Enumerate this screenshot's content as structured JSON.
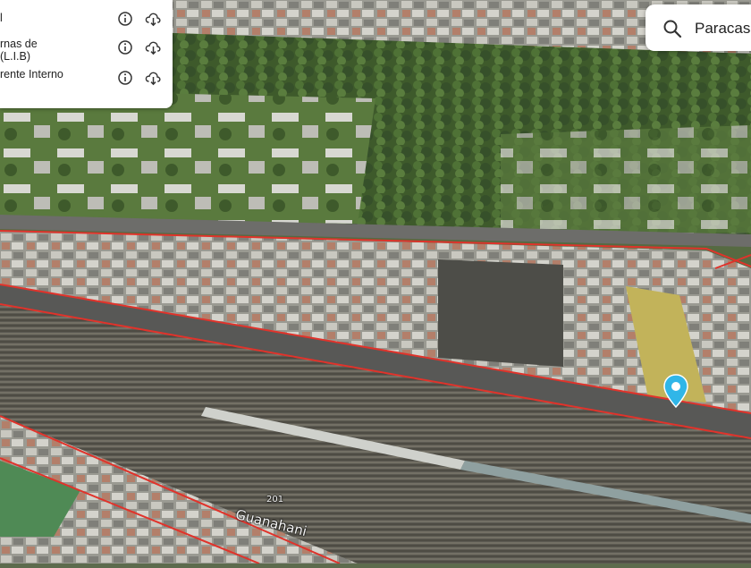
{
  "layers_panel": {
    "items": [
      {
        "label": "l",
        "info_icon": "info-icon",
        "download_icon": "cloud-download-icon"
      },
      {
        "label": "rnas de\n(L.I.B)",
        "info_icon": "info-icon",
        "download_icon": "cloud-download-icon"
      },
      {
        "label": "rente Interno",
        "info_icon": "info-icon",
        "download_icon": "cloud-download-icon"
      }
    ]
  },
  "search": {
    "value": "Paracas",
    "icon": "search-icon"
  },
  "map": {
    "road_labels": {
      "route_number": "201",
      "street_name": "Guanahani"
    },
    "boundary_color": "#e0332b",
    "marker_color": "#30b6e8",
    "marker_icon": "location-pin-icon"
  }
}
